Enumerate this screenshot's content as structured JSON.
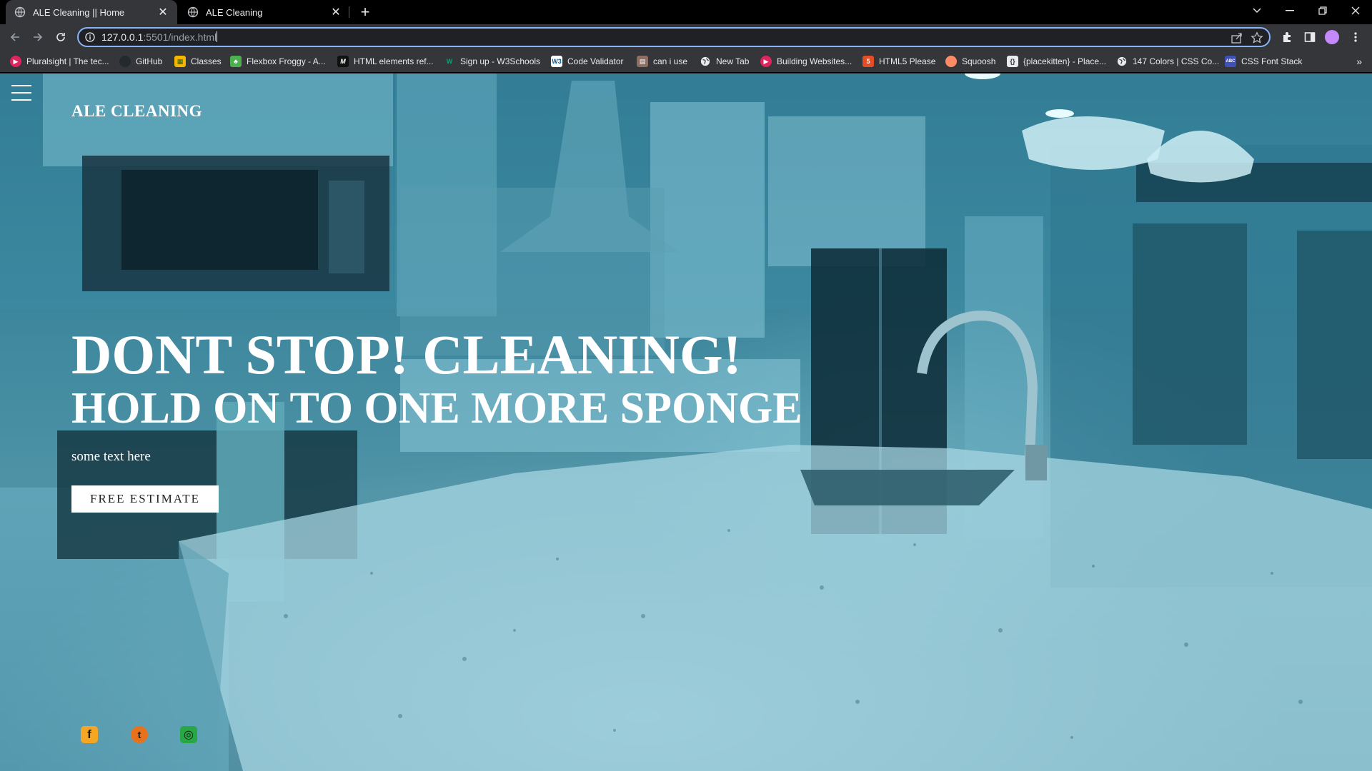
{
  "browser": {
    "tabs": [
      {
        "title": "ALE Cleaning || Home",
        "active": true
      },
      {
        "title": "ALE Cleaning",
        "active": false
      }
    ],
    "new_tab_label": "+",
    "url_host": "127.0.0.1",
    "url_path": ":5501/index.html",
    "bookmarks": [
      {
        "label": "Pluralsight | The tec...",
        "icon": "pluralsight-icon",
        "color": "#e0245e"
      },
      {
        "label": "GitHub",
        "icon": "github-icon",
        "color": "#24292e"
      },
      {
        "label": "Classes",
        "icon": "classroom-icon",
        "color": "#f4b400"
      },
      {
        "label": "Flexbox Froggy - A...",
        "icon": "frog-icon",
        "color": "#4caf50"
      },
      {
        "label": "HTML elements ref...",
        "icon": "mdn-icon",
        "color": "#111111"
      },
      {
        "label": "Sign up - W3Schools",
        "icon": "w3schools-icon",
        "color": "#04aa6d"
      },
      {
        "label": "Code Validator",
        "icon": "w3c-icon",
        "color": "#005a9c"
      },
      {
        "label": "can i use",
        "icon": "caniuse-icon",
        "color": "#8d6e63"
      },
      {
        "label": "New Tab",
        "icon": "globe-icon",
        "color": "#5f6368"
      },
      {
        "label": "Building Websites...",
        "icon": "pluralsight-icon",
        "color": "#e0245e"
      },
      {
        "label": "HTML5 Please",
        "icon": "html5-icon",
        "color": "#e44d26"
      },
      {
        "label": "Squoosh",
        "icon": "squoosh-icon",
        "color": "#ff8a65"
      },
      {
        "label": "{placekitten} - Place...",
        "icon": "placekitten-icon",
        "color": "#9e9e9e"
      },
      {
        "label": "147 Colors | CSS Co...",
        "icon": "globe-icon",
        "color": "#5f6368"
      },
      {
        "label": "CSS Font Stack",
        "icon": "cssfontstack-icon",
        "color": "#3f51b5"
      }
    ],
    "bookmarks_more": "»"
  },
  "page": {
    "logo": "ALE CLEANING",
    "headline_1": "DONT STOP! CLEANING!",
    "headline_2": "HOLD ON TO ONE MORE SPONGE",
    "subtext": "some text here",
    "cta_label": "FREE ESTIMATE",
    "social": [
      {
        "name": "facebook-icon",
        "glyph": "f",
        "bg": "#f5a623",
        "fg": "#1a1a1a"
      },
      {
        "name": "twitter-icon",
        "glyph": "t",
        "bg": "#e8711c",
        "fg": "#1a1a1a"
      },
      {
        "name": "instagram-icon",
        "glyph": "◎",
        "bg": "#28a745",
        "fg": "#1a1a1a"
      }
    ]
  }
}
